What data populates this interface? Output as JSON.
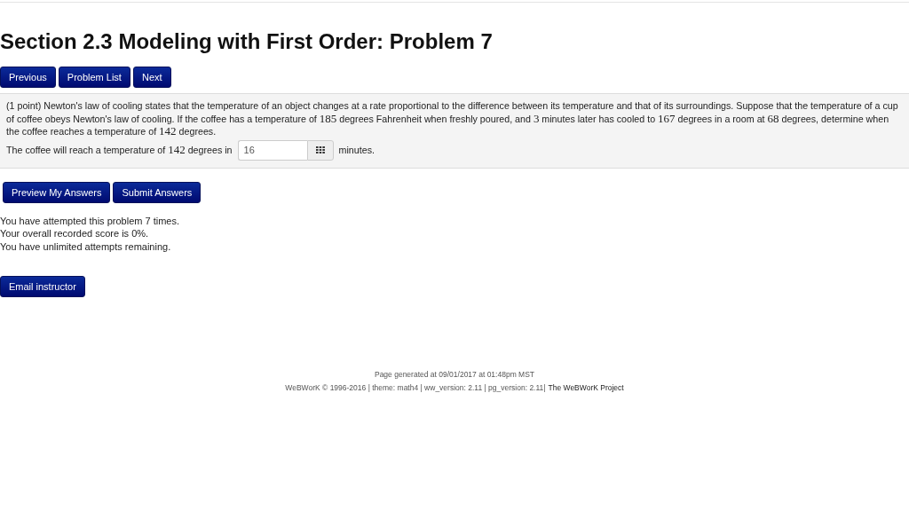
{
  "title": "Section 2.3 Modeling with First Order: Problem 7",
  "nav_buttons": [
    "Previous",
    "Problem List",
    "Next"
  ],
  "problem": {
    "statement": [
      {
        "kind": "text",
        "text": "(1 point) Newton's law of cooling states that the temperature of an object changes at a rate proportional to the difference between its temperature and that of its surroundings. Suppose that the temperature of a cup of coffee obeys Newton's law of cooling. If the coffee has a temperature of "
      },
      {
        "kind": "math",
        "text": "185"
      },
      {
        "kind": "text",
        "text": " degrees Fahrenheit when freshly poured, and "
      },
      {
        "kind": "math",
        "text": "3"
      },
      {
        "kind": "text",
        "text": " minutes later has cooled to "
      },
      {
        "kind": "math",
        "text": "167"
      },
      {
        "kind": "text",
        "text": " degrees in a room at "
      },
      {
        "kind": "math",
        "text": "68"
      },
      {
        "kind": "text",
        "text": " degrees, determine when the coffee reaches a temperature of "
      },
      {
        "kind": "math",
        "text": "142"
      },
      {
        "kind": "text",
        "text": " degrees."
      }
    ],
    "answer_prompt": [
      {
        "kind": "text",
        "text": "The coffee will reach a temperature of "
      },
      {
        "kind": "math",
        "text": "142"
      },
      {
        "kind": "text",
        "text": " degrees in"
      }
    ],
    "answer_value": "16",
    "answer_unit": "minutes."
  },
  "action_buttons": [
    "Preview My Answers",
    "Submit Answers"
  ],
  "attempt_messages": [
    "You have attempted this problem 7 times.",
    "Your overall recorded score is 0%.",
    "You have unlimited attempts remaining."
  ],
  "email_button": "Email instructor",
  "footer": {
    "generated": "Page generated at 09/01/2017 at 01:48pm MST",
    "version_info": "WeBWorK © 1996-2016 | theme: math4 | ww_version: 2.11 | pg_version: 2.11|",
    "project_link": "The WeBWorK Project"
  }
}
